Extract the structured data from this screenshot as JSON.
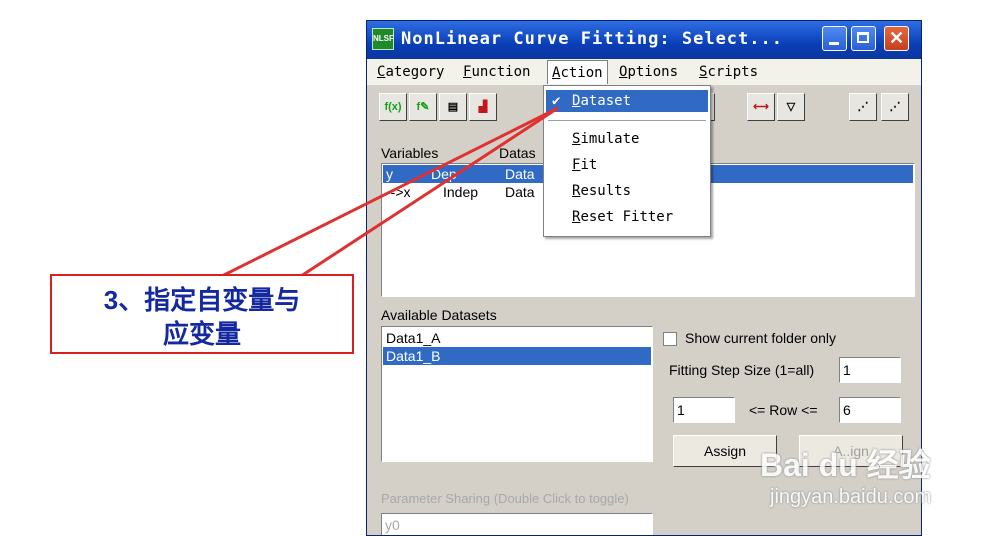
{
  "window": {
    "title": "NonLinear Curve Fitting:  Select...",
    "icon_text": "NLSF"
  },
  "menubar": {
    "items": [
      "Category",
      "Function",
      "Action",
      "Options",
      "Scripts"
    ]
  },
  "action_menu": {
    "items": [
      "Dataset",
      "Simulate",
      "Fit",
      "Results",
      "Reset Fitter"
    ],
    "checked": "Dataset"
  },
  "variables": {
    "label": "Variables",
    "datasets_label": "Datas",
    "rows": [
      {
        "name": "y",
        "type": "Dep",
        "dataset": "Data"
      },
      {
        "name": "-->x",
        "type": "Indep",
        "dataset": "Data"
      }
    ]
  },
  "available": {
    "label": "Available Datasets",
    "items": [
      "Data1_A",
      "Data1_B"
    ],
    "selected": "Data1_B"
  },
  "options": {
    "show_folder_label": "Show current folder only",
    "step_label": "Fitting Step Size (1=all)",
    "step_value": "1",
    "row_from": "1",
    "row_label": "<= Row <=",
    "row_to": "6",
    "assign_label": "Assign",
    "assign2_label": "A..ign"
  },
  "parameter_sharing": {
    "label": "Parameter Sharing (Double Click to toggle)",
    "first": "y0"
  },
  "callout": {
    "line1": "3、指定自变量与",
    "line2": "应变量"
  },
  "watermark": {
    "logo": "Bai du 经验",
    "url": "jingyan.baidu.com"
  },
  "colors": {
    "selection": "#316ac5",
    "callout_border": "#d82020",
    "callout_text": "#1428a0"
  }
}
